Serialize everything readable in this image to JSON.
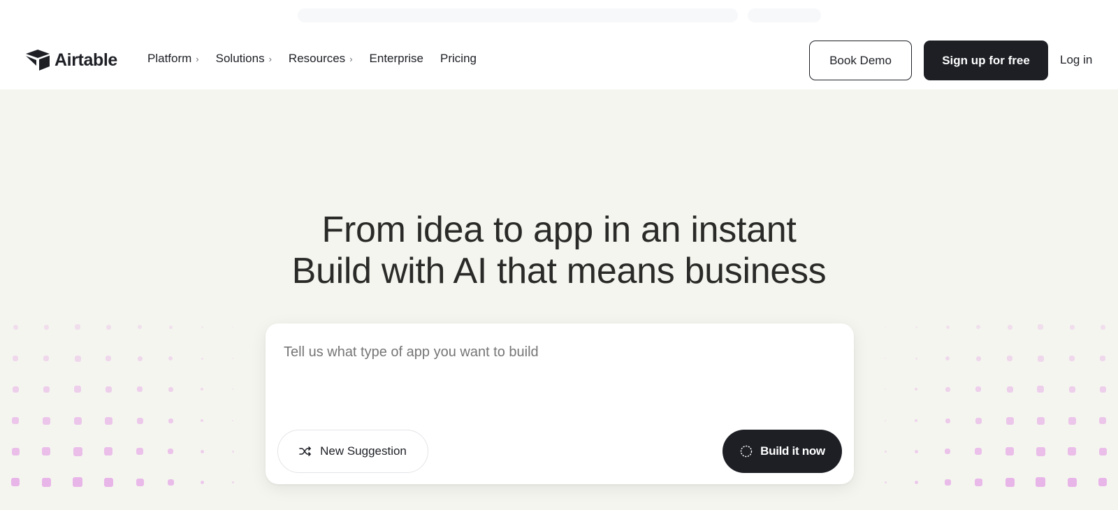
{
  "brand": {
    "name": "Airtable"
  },
  "nav": {
    "items": [
      {
        "label": "Platform",
        "has_submenu": true
      },
      {
        "label": "Solutions",
        "has_submenu": true
      },
      {
        "label": "Resources",
        "has_submenu": true
      },
      {
        "label": "Enterprise",
        "has_submenu": false
      },
      {
        "label": "Pricing",
        "has_submenu": false
      }
    ],
    "chevron": "›"
  },
  "actions": {
    "book_demo": "Book Demo",
    "sign_up": "Sign up for free",
    "log_in": "Log in"
  },
  "hero": {
    "line1": "From idea to app in an instant",
    "line2": "Build with AI that means business"
  },
  "prompt": {
    "placeholder": "Tell us what type of app you want to build",
    "suggestion_label": "New Suggestion",
    "build_label": "Build it now"
  },
  "icons": {
    "logo": "airtable-logo-icon",
    "shuffle": "shuffle-icon",
    "build": "sparkle-loader-icon"
  },
  "colors": {
    "page_bg": "#f5f5f0",
    "dark": "#1d1f25",
    "dot_accent": "#e8b5e8"
  }
}
